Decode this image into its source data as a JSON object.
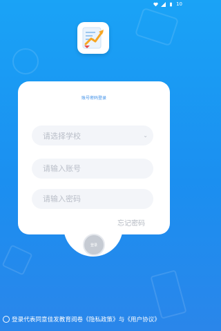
{
  "status_bar": {
    "time": "10"
  },
  "login": {
    "title": "账号密码登录",
    "school_placeholder": "请选择学校",
    "account_placeholder": "请输入账号",
    "password_placeholder": "请输入密码",
    "forgot_password": "忘记密码",
    "login_button": "登录"
  },
  "agreement": {
    "prefix": "登录代表同意佳发教育阅卷",
    "privacy_link": "《隐私政策》",
    "conjunction": "与",
    "user_link": "《用户协议》"
  },
  "colors": {
    "background": "#1b8ff0",
    "accent": "#3d8fe8",
    "card": "#ffffff"
  }
}
